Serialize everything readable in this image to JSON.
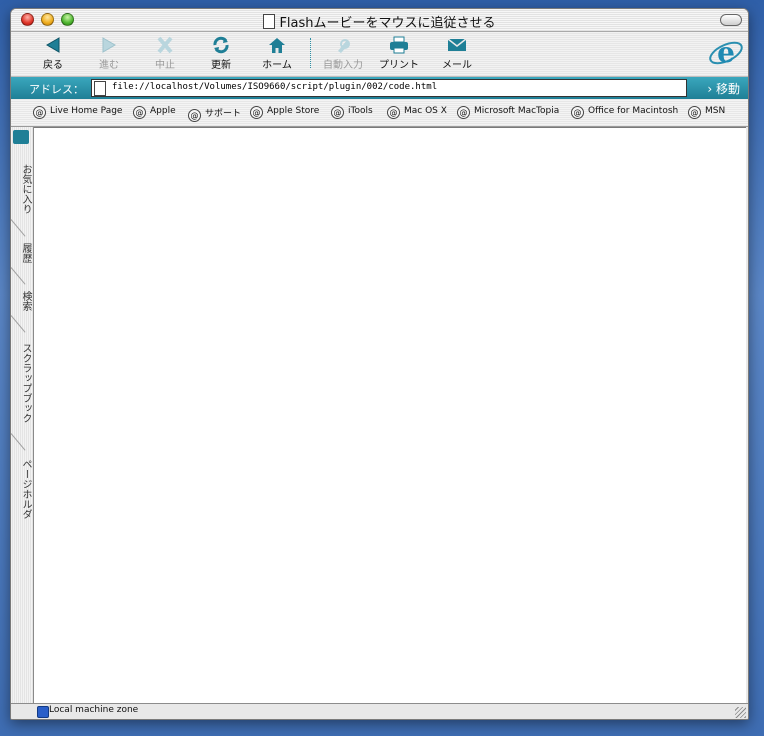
{
  "window": {
    "title": "Flashムービーをマウスに追従させる"
  },
  "toolbar": {
    "buttons": [
      {
        "label": "戻る",
        "icon": "back-arrow-icon",
        "enabled": true
      },
      {
        "label": "進む",
        "icon": "forward-arrow-icon",
        "enabled": false
      },
      {
        "label": "中止",
        "icon": "stop-x-icon",
        "enabled": false
      },
      {
        "label": "更新",
        "icon": "refresh-icon",
        "enabled": true
      },
      {
        "label": "ホーム",
        "icon": "home-icon",
        "enabled": true
      },
      {
        "label": "自動入力",
        "icon": "autofill-pen-icon",
        "enabled": false
      },
      {
        "label": "プリント",
        "icon": "printer-icon",
        "enabled": true
      },
      {
        "label": "メール",
        "icon": "mail-icon",
        "enabled": true
      }
    ],
    "accent": "#1f7f96"
  },
  "address": {
    "label": "アドレス：",
    "url": "file://localhost/Volumes/ISO9660/script/plugin/002/code.html",
    "go_label": "移動"
  },
  "favorites": [
    "Live Home Page",
    "Apple",
    "サポート",
    "Apple Store",
    "iTools",
    "Mac OS X",
    "Microsoft MacTopia",
    "Office for Macintosh",
    "MSN"
  ],
  "sidebar": {
    "tabs": [
      "お気に入り",
      "履歴",
      "検索",
      "スクラップブック",
      "ページホルダ"
    ]
  },
  "status": {
    "zone": "Local machine zone"
  }
}
